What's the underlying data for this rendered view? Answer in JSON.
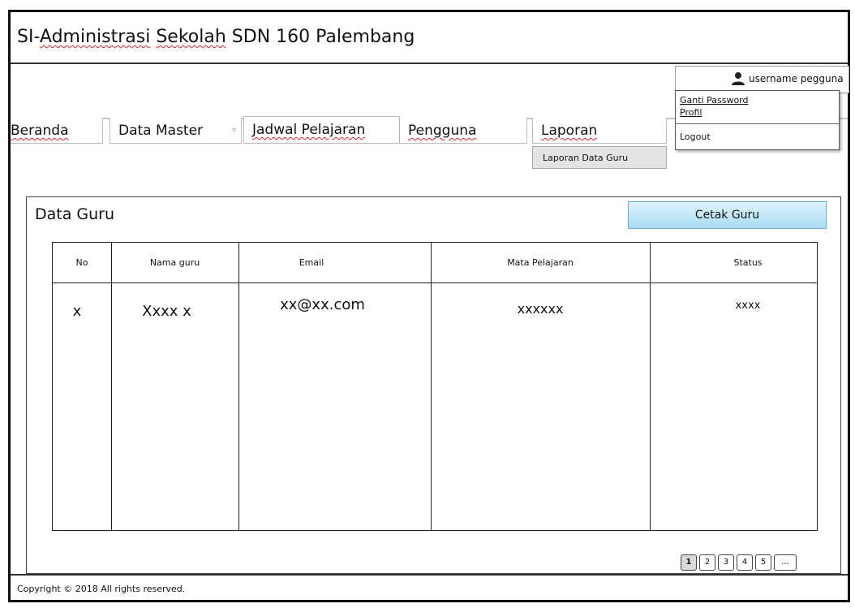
{
  "app": {
    "title_prefix": "SI-",
    "title_word1": "Administrasi",
    "title_space": " ",
    "title_word2": "Sekolah",
    "title_suffix": " SDN 160 Palembang"
  },
  "user": {
    "name": "username pegguna",
    "menu": {
      "change_password": "Ganti Password",
      "profile": "Profil",
      "logout": "Logout"
    }
  },
  "nav": {
    "items": [
      {
        "label": "Beranda"
      },
      {
        "label": "Data Master"
      },
      {
        "label": "Jadwal Pelajaran"
      },
      {
        "label": "Pengguna"
      },
      {
        "label": "Laporan"
      }
    ],
    "dropdown_caret": "▿",
    "laporan_submenu": [
      "Laporan Data Guru"
    ]
  },
  "panel": {
    "title": "Data Guru",
    "print_button": "Cetak Guru",
    "table": {
      "columns": [
        "No",
        "Nama guru",
        "Email",
        "Mata Pelajaran",
        "Status"
      ],
      "rows": [
        [
          "x",
          "Xxxx x",
          "xx@xx.com",
          "xxxxxx",
          "xxxx"
        ]
      ]
    },
    "pagination": {
      "pages": [
        "1",
        "2",
        "3",
        "4",
        "5"
      ],
      "more": "…",
      "current": "1"
    }
  },
  "footer": {
    "copyright": "Copyright © 2018  All rights reserved."
  },
  "colors": {
    "button_top": "#dff3fd",
    "button_bottom": "#a9ddf5",
    "spellcheck": "#d23"
  },
  "icons": {
    "user": "user-icon",
    "caret": "chevron-down-icon"
  }
}
